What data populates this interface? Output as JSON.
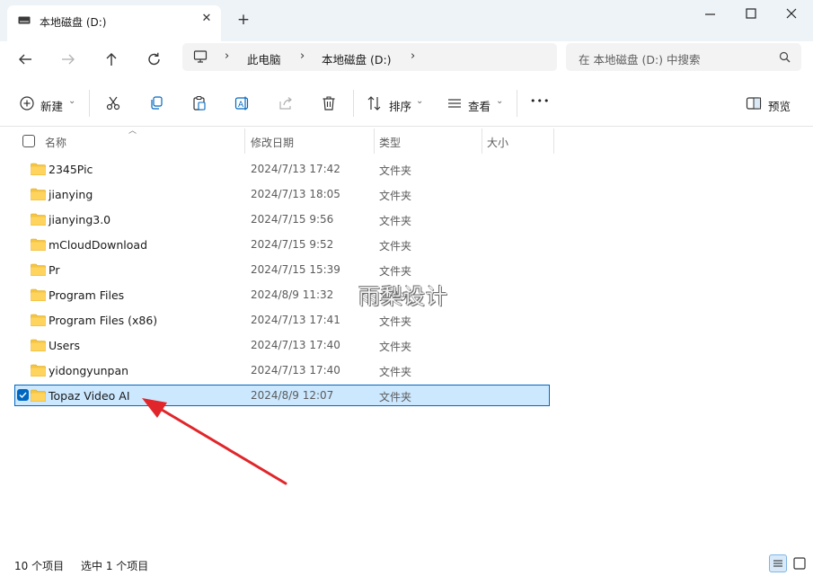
{
  "window": {
    "tab_title": "本地磁盘 (D:)",
    "close_tab_glyph": "✕",
    "new_tab_glyph": "+"
  },
  "address": {
    "crumbs": [
      "此电脑",
      "本地磁盘 (D:)"
    ],
    "search_placeholder": "在 本地磁盘 (D:) 中搜索"
  },
  "toolbar": {
    "new_label": "新建",
    "sort_label": "排序",
    "view_label": "查看",
    "preview_label": "预览",
    "more_glyph": "•••"
  },
  "columns": {
    "name": "名称",
    "date": "修改日期",
    "type": "类型",
    "size": "大小"
  },
  "files": [
    {
      "name": "2345Pic",
      "date": "2024/7/13 17:42",
      "type": "文件夹"
    },
    {
      "name": "jianying",
      "date": "2024/7/13 18:05",
      "type": "文件夹"
    },
    {
      "name": "jianying3.0",
      "date": "2024/7/15 9:56",
      "type": "文件夹"
    },
    {
      "name": "mCloudDownload",
      "date": "2024/7/15 9:52",
      "type": "文件夹"
    },
    {
      "name": "Pr",
      "date": "2024/7/15 15:39",
      "type": "文件夹"
    },
    {
      "name": "Program Files",
      "date": "2024/8/9 11:32",
      "type": "文件夹"
    },
    {
      "name": "Program Files (x86)",
      "date": "2024/7/13 17:41",
      "type": "文件夹"
    },
    {
      "name": "Users",
      "date": "2024/7/13 17:40",
      "type": "文件夹"
    },
    {
      "name": "yidongyunpan",
      "date": "2024/7/13 17:40",
      "type": "文件夹"
    },
    {
      "name": "Topaz Video AI",
      "date": "2024/8/9 12:07",
      "type": "文件夹",
      "selected": true
    }
  ],
  "status": {
    "item_count": "10 个项目",
    "selected_count": "选中 1 个项目"
  },
  "watermark": "雨梨设计",
  "colors": {
    "accent": "#0067c0",
    "selection": "#cce8ff",
    "folder": "#f5c542",
    "annotation_arrow": "#e0262b"
  }
}
